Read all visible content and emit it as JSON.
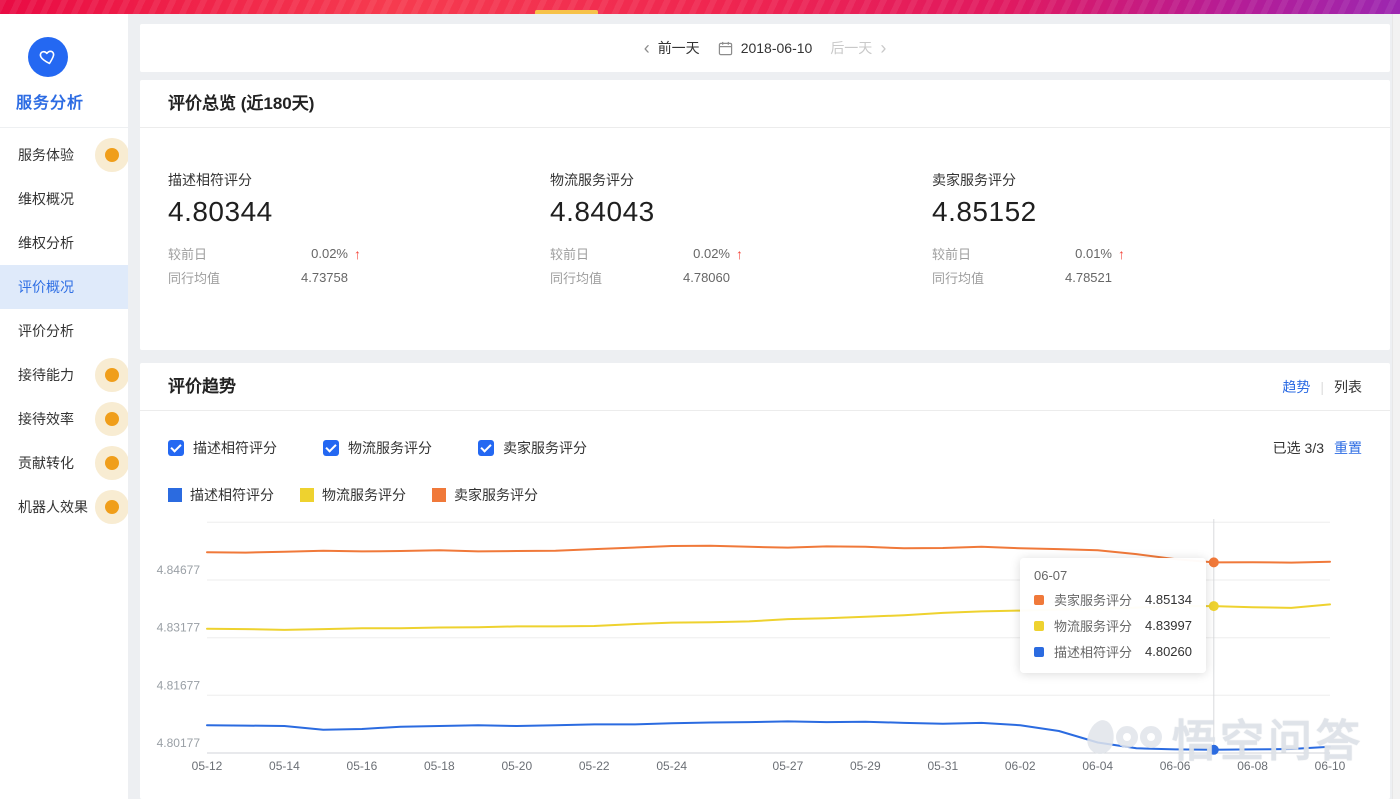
{
  "banner": {
    "yellow_accent": "#f6c24a"
  },
  "datebar": {
    "prev_chevron": "‹",
    "prev": "前一天",
    "date": "2018-06-10",
    "next": "后一天",
    "next_chevron": "›"
  },
  "sidebar": {
    "title": "服务分析",
    "items": [
      {
        "label": "服务体验"
      },
      {
        "label": "维权概况"
      },
      {
        "label": "维权分析"
      },
      {
        "label": "评价概况"
      },
      {
        "label": "评价分析"
      },
      {
        "label": "接待能力"
      },
      {
        "label": "接待效率"
      },
      {
        "label": "贡献转化"
      },
      {
        "label": "机器人效果"
      }
    ]
  },
  "overview": {
    "title": "评价总览 (近180天)",
    "metrics": [
      {
        "name": "描述相符评分",
        "value": "4.80344",
        "change_label": "较前日",
        "change": "0.02%",
        "arrow": "↑",
        "peer_label": "同行均值",
        "peer": "4.73758"
      },
      {
        "name": "物流服务评分",
        "value": "4.84043",
        "change_label": "较前日",
        "change": "0.02%",
        "arrow": "↑",
        "peer_label": "同行均值",
        "peer": "4.78060"
      },
      {
        "name": "卖家服务评分",
        "value": "4.85152",
        "change_label": "较前日",
        "change": "0.01%",
        "arrow": "↑",
        "peer_label": "同行均值",
        "peer": "4.78521"
      }
    ]
  },
  "trend": {
    "title": "评价趋势",
    "view_trend": "趋势",
    "divider": "|",
    "view_list": "列表",
    "selected": "已选 3/3",
    "reset": "重置",
    "checkboxes": [
      {
        "label": "描述相符评分",
        "checked": true
      },
      {
        "label": "物流服务评分",
        "checked": true
      },
      {
        "label": "卖家服务评分",
        "checked": true
      }
    ],
    "legend": [
      {
        "label": "描述相符评分",
        "color": "#2b6be0"
      },
      {
        "label": "物流服务评分",
        "color": "#eed22f"
      },
      {
        "label": "卖家服务评分",
        "color": "#f0793a"
      }
    ]
  },
  "tooltip": {
    "date": "06-07",
    "rows": [
      {
        "name": "卖家服务评分",
        "value": "4.85134",
        "color": "#f0793a"
      },
      {
        "name": "物流服务评分",
        "value": "4.83997",
        "color": "#eed22f"
      },
      {
        "name": "描述相符评分",
        "value": "4.80260",
        "color": "#2b6be0"
      }
    ]
  },
  "watermark": {
    "text": "悟空问答"
  },
  "chart_data": {
    "type": "line",
    "x": [
      "05-12",
      "05-13",
      "05-14",
      "05-15",
      "05-16",
      "05-17",
      "05-18",
      "05-19",
      "05-20",
      "05-21",
      "05-22",
      "05-23",
      "05-24",
      "05-25",
      "05-26",
      "05-27",
      "05-28",
      "05-29",
      "05-30",
      "05-31",
      "06-01",
      "06-02",
      "06-03",
      "06-04",
      "06-05",
      "06-06",
      "06-07",
      "06-08",
      "06-09",
      "06-10"
    ],
    "xtick_indices": [
      0,
      2,
      4,
      6,
      8,
      10,
      12,
      15,
      17,
      19,
      21,
      23,
      25,
      27,
      29
    ],
    "yticks": [
      4.80177,
      4.81677,
      4.83177,
      4.84677,
      4.86177
    ],
    "ytick_labels": [
      "4.80177",
      "4.81677",
      "4.83177",
      "4.84677"
    ],
    "ylim": [
      4.80177,
      4.86177
    ],
    "hover_index": 26,
    "legend_position": "top",
    "grid": true,
    "series": [
      {
        "name": "描述相符评分",
        "color": "#2b6be0",
        "values": [
          4.809,
          4.8089,
          4.8088,
          4.8078,
          4.808,
          4.8086,
          4.8088,
          4.809,
          4.8088,
          4.809,
          4.8092,
          4.8092,
          4.8095,
          4.8097,
          4.8098,
          4.81,
          4.8098,
          4.8099,
          4.8096,
          4.8094,
          4.8096,
          4.809,
          4.8075,
          4.8045,
          4.803,
          4.8027,
          4.8026,
          4.8027,
          4.8028,
          4.8034
        ]
      },
      {
        "name": "物流服务评分",
        "color": "#eed22f",
        "values": [
          4.8341,
          4.834,
          4.8338,
          4.834,
          4.8342,
          4.8342,
          4.8344,
          4.8345,
          4.8347,
          4.8347,
          4.8348,
          4.8353,
          4.8357,
          4.8358,
          4.836,
          4.8366,
          4.8368,
          4.8372,
          4.8376,
          4.8382,
          4.8386,
          4.8388,
          4.8391,
          4.8393,
          4.8396,
          4.84,
          4.83997,
          4.8397,
          4.8395,
          4.84043
        ]
      },
      {
        "name": "卖家服务评分",
        "color": "#f0793a",
        "values": [
          4.854,
          4.8539,
          4.8541,
          4.8544,
          4.8542,
          4.8543,
          4.8545,
          4.8542,
          4.8543,
          4.8544,
          4.8548,
          4.8552,
          4.8556,
          4.8557,
          4.8554,
          4.8552,
          4.8555,
          4.8554,
          4.855,
          4.8551,
          4.8554,
          4.855,
          4.8548,
          4.8545,
          4.8535,
          4.8522,
          4.85134,
          4.8514,
          4.8513,
          4.85152
        ]
      }
    ]
  }
}
